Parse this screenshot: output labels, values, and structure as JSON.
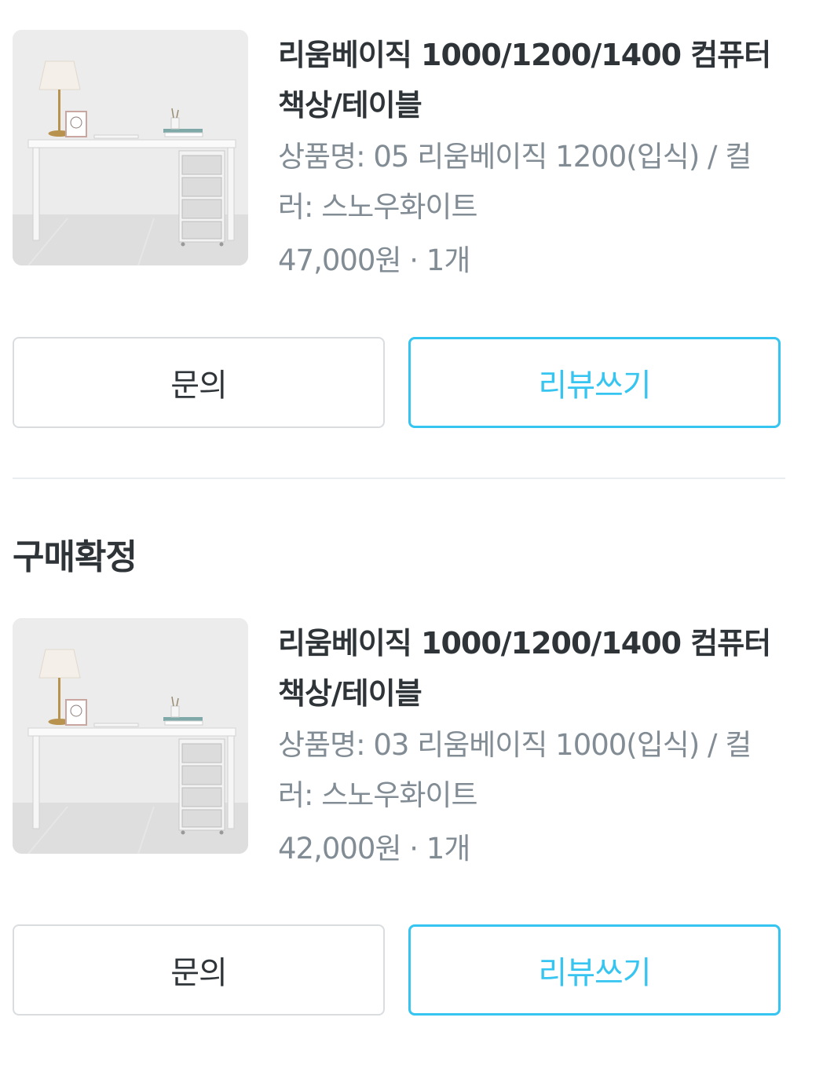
{
  "orders": [
    {
      "product_name": "리움베이직 1000/1200/1400 컴퓨터책상/테이블",
      "option": "상품명: 05 리움베이직 1200(입식) / 컬러: 스노우화이트",
      "price_qty": "47,000원 · 1개",
      "thumbnail_icon": "desk-product-image",
      "inquiry_label": "문의",
      "review_label": "리뷰쓰기"
    },
    {
      "product_name": "리움베이직 1000/1200/1400 컴퓨터책상/테이블",
      "option": "상품명: 03 리움베이직 1000(입식) / 컬러: 스노우화이트",
      "price_qty": "42,000원 · 1개",
      "thumbnail_icon": "desk-product-image",
      "inquiry_label": "문의",
      "review_label": "리뷰쓰기"
    }
  ],
  "section": {
    "title": "구매확정"
  },
  "colors": {
    "accent": "#35c5f0",
    "text_primary": "#2f3438",
    "text_secondary": "#828c94",
    "border": "#dadde0"
  }
}
